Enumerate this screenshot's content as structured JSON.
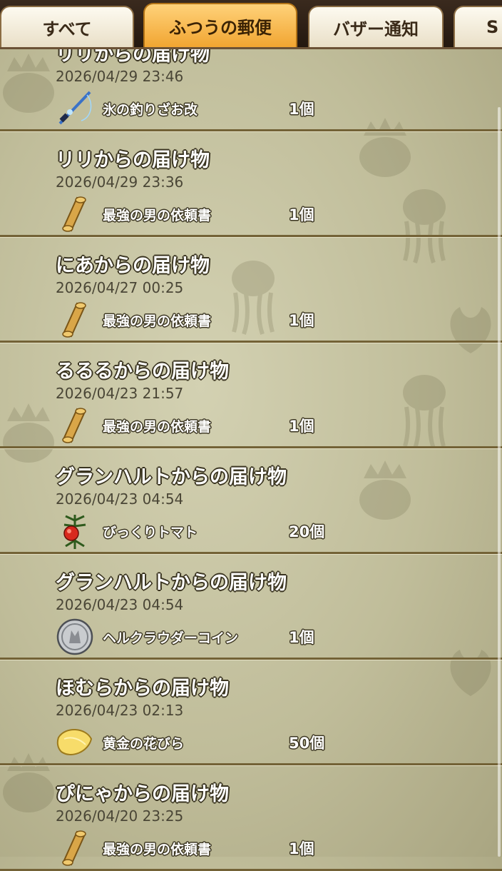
{
  "tabs": [
    {
      "label": "すべて",
      "active": false
    },
    {
      "label": "ふつうの郵便",
      "active": true
    },
    {
      "label": "バザー通知",
      "active": false
    },
    {
      "label": "S",
      "active": false
    }
  ],
  "mails": [
    {
      "title": "リリからの届け物",
      "date": "2026/04/29 23:46",
      "item": "氷の釣りざお改",
      "count": "1個",
      "icon": "fishing-rod-icon"
    },
    {
      "title": "リリからの届け物",
      "date": "2026/04/29 23:36",
      "item": "最強の男の依頼書",
      "count": "1個",
      "icon": "scroll-icon"
    },
    {
      "title": "にあからの届け物",
      "date": "2026/04/27 00:25",
      "item": "最強の男の依頼書",
      "count": "1個",
      "icon": "scroll-icon"
    },
    {
      "title": "るるるからの届け物",
      "date": "2026/04/23 21:57",
      "item": "最強の男の依頼書",
      "count": "1個",
      "icon": "scroll-icon"
    },
    {
      "title": "グランハルトからの届け物",
      "date": "2026/04/23 04:54",
      "item": "びっくりトマト",
      "count": "20個",
      "icon": "tomato-icon"
    },
    {
      "title": "グランハルトからの届け物",
      "date": "2026/04/23 04:54",
      "item": "ヘルクラウダーコイン",
      "count": "1個",
      "icon": "coin-icon"
    },
    {
      "title": "ほむらからの届け物",
      "date": "2026/04/23 02:13",
      "item": "黄金の花びら",
      "count": "50個",
      "icon": "petal-icon"
    },
    {
      "title": "ぴにゃからの届け物",
      "date": "2026/04/20 23:25",
      "item": "最強の男の依頼書",
      "count": "1個",
      "icon": "scroll-icon"
    }
  ],
  "colors": {
    "tab_active": "#f1a531",
    "tab_inactive": "#f3ecd9",
    "tabbar_bg": "#2b1d12",
    "list_bg": "#c3c0a0",
    "divider": "#736236"
  }
}
